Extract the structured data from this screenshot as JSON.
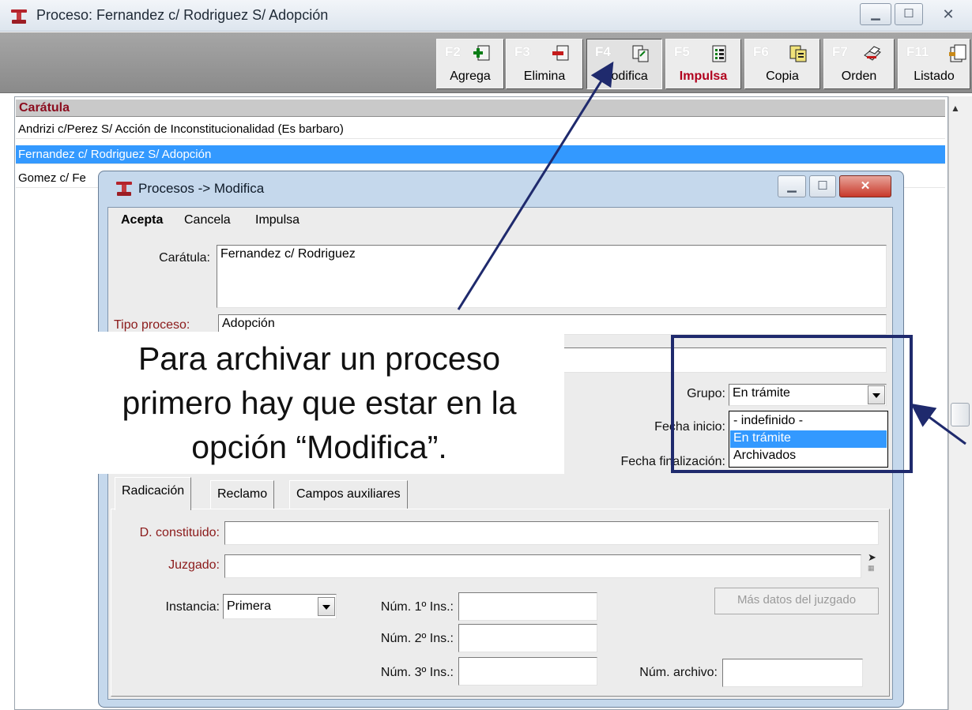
{
  "main_window": {
    "title": "Proceso: Fernandez c/ Rodriguez S/ Adopción",
    "controls": [
      "minimize",
      "maximize",
      "close"
    ]
  },
  "toolbar": {
    "buttons": [
      {
        "key": "F2",
        "label": "Agrega",
        "icon": "add-document-icon"
      },
      {
        "key": "F3",
        "label": "Elimina",
        "icon": "delete-document-icon"
      },
      {
        "key": "F4",
        "label": "Modifica",
        "icon": "modify-document-icon"
      },
      {
        "key": "F5",
        "label": "Impulsa",
        "icon": "impulsa-list-icon"
      },
      {
        "key": "F6",
        "label": "Copia",
        "icon": "copy-document-icon"
      },
      {
        "key": "F7",
        "label": "Orden",
        "icon": "print-order-icon"
      },
      {
        "key": "F11",
        "label": "Listado",
        "icon": "listing-icon"
      }
    ]
  },
  "list": {
    "header": "Carátula",
    "rows": [
      "Andrizi c/Perez S/ Acción de Inconstitucionalidad (Es barbaro)",
      "Fernandez c/ Rodriguez S/ Adopción",
      "Gomez c/ Fe"
    ],
    "selected_index": 1
  },
  "dialog": {
    "title": "Procesos -> Modifica",
    "menu": [
      "Acepta",
      "Cancela",
      "Impulsa"
    ],
    "caratula_label": "Carátula:",
    "caratula_value": "Fernandez c/ Rodriguez",
    "tipo_label": "Tipo proceso:",
    "tipo_value": "Adopción",
    "grupo_label": "Grupo:",
    "grupo_value": "En trámite",
    "grupo_options": [
      "- indefinido -",
      "En trámite",
      "Archivados"
    ],
    "grupo_selected_index": 1,
    "fecha_inicio_label": "Fecha inicio:",
    "fecha_fin_label": "Fecha finalización:",
    "tabs": [
      "Radicación",
      "Reclamo",
      "Campos auxiliares"
    ],
    "active_tab": 0,
    "d_constituido_label": "D. constituido:",
    "juzgado_label": "Juzgado:",
    "instancia_label": "Instancia:",
    "instancia_value": "Primera",
    "num1_label": "Núm. 1º Ins.:",
    "num2_label": "Núm. 2º Ins.:",
    "num3_label": "Núm. 3º Ins.:",
    "mas_datos_label": "Más datos del juzgado",
    "num_archivo_label": "Núm. archivo:"
  },
  "annotation": {
    "line1": "Para archivar un proceso",
    "line2": "primero hay que estar en la",
    "line3": "opción “Modifica”."
  },
  "colors": {
    "selection": "#3399ff",
    "accent_red": "#8b0c1e",
    "annotation_navy": "#1f2a6d"
  }
}
